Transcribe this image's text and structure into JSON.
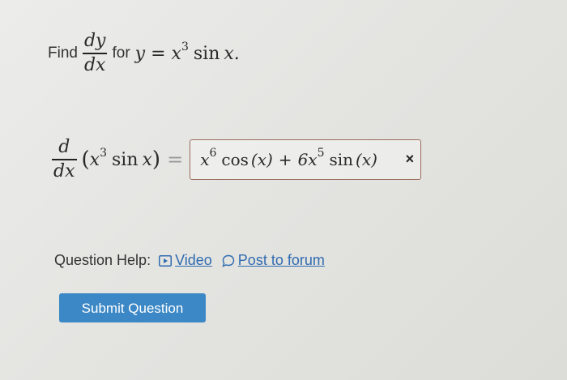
{
  "question": {
    "find_label": "Find",
    "deriv_num": "dy",
    "deriv_den": "dx",
    "for_label": "for",
    "y_var": "y",
    "equals": "=",
    "x_var": "x",
    "x_exp": "3",
    "sin": "sin",
    "x_end": "x."
  },
  "answer_line": {
    "d_num": "d",
    "d_den": "dx",
    "open_paren": "(",
    "x_var": "x",
    "x_exp": "3",
    "sin": "sin",
    "x_arg": "x",
    "close_paren": ")",
    "equals": "="
  },
  "answer": {
    "term1_base": "x",
    "term1_exp": "6",
    "term1_func": "cos",
    "term1_arg": "(x)",
    "plus": "+",
    "term2_base": "6x",
    "term2_exp": "5",
    "term2_func": "sin",
    "term2_arg": "(x)",
    "incorrect_mark": "×"
  },
  "help": {
    "label": "Question Help:",
    "video_label": "Video",
    "forum_label": "Post to forum",
    "video_icon": "video-play-icon",
    "forum_icon": "chat-bubble-icon"
  },
  "submit_label": "Submit Question",
  "colors": {
    "link": "#2f6bb0",
    "button": "#3c88c6",
    "answer_border": "#9b6d5d"
  }
}
